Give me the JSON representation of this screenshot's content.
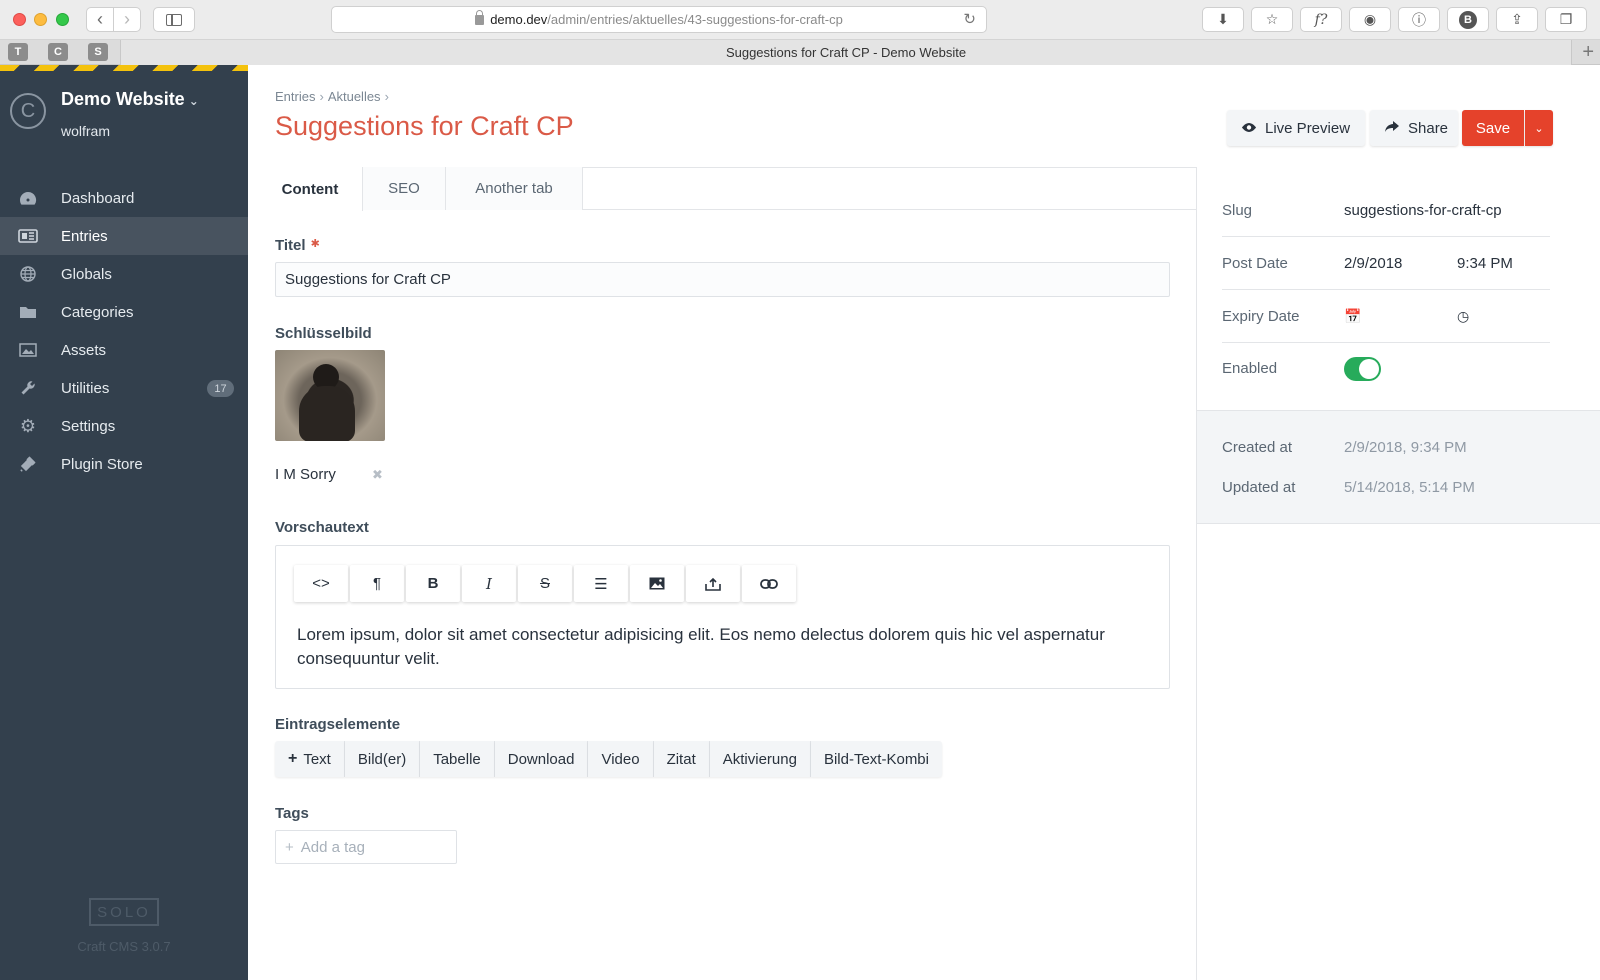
{
  "browser": {
    "url_host": "demo.dev",
    "url_path": "/admin/entries/aktuelles/43-suggestions-for-craft-cp",
    "tab_title": "Suggestions for Craft CP - Demo Website",
    "extensions": [
      "T",
      "C",
      "S"
    ]
  },
  "sidebar": {
    "site_name": "Demo Website",
    "user": "wolfram",
    "items": [
      {
        "label": "Dashboard",
        "icon": "dashboard-icon"
      },
      {
        "label": "Entries",
        "icon": "entries-icon",
        "active": true
      },
      {
        "label": "Globals",
        "icon": "globe-icon"
      },
      {
        "label": "Categories",
        "icon": "folder-icon"
      },
      {
        "label": "Assets",
        "icon": "image-icon"
      },
      {
        "label": "Utilities",
        "icon": "wrench-icon",
        "badge": "17"
      },
      {
        "label": "Settings",
        "icon": "gear-icon"
      },
      {
        "label": "Plugin Store",
        "icon": "plug-icon"
      }
    ],
    "edition": "SOLO",
    "version": "Craft CMS 3.0.7"
  },
  "header": {
    "breadcrumb": [
      "Entries",
      "Aktuelles"
    ],
    "title": "Suggestions for Craft CP",
    "live_preview": "Live Preview",
    "share": "Share",
    "save": "Save"
  },
  "tabs": [
    "Content",
    "SEO",
    "Another tab"
  ],
  "fields": {
    "title_label": "Titel",
    "title_value": "Suggestions for Craft CP",
    "image_label": "Schlüsselbild",
    "image_title": "I M Sorry",
    "preview_label": "Vorschautext",
    "preview_text": "Lorem ipsum, dolor sit amet consectetur adipisicing elit. Eos nemo delectus dolorem quis hic vel aspernatur consequuntur velit.",
    "toolbar": [
      "code-icon",
      "paragraph-icon",
      "bold-icon",
      "italic-icon",
      "strikethrough-icon",
      "list-icon",
      "image-icon",
      "upload-icon",
      "link-icon"
    ],
    "elements_label": "Eintragselemente",
    "elements": [
      "Text",
      "Bild(er)",
      "Tabelle",
      "Download",
      "Video",
      "Zitat",
      "Aktivierung",
      "Bild-Text-Kombi"
    ],
    "tags_label": "Tags",
    "tags_placeholder": "Add a tag"
  },
  "details": {
    "slug_label": "Slug",
    "slug": "suggestions-for-craft-cp",
    "post_date_label": "Post Date",
    "post_date": "2/9/2018",
    "post_time": "9:34 PM",
    "expiry_label": "Expiry Date",
    "enabled_label": "Enabled",
    "enabled": true,
    "created_label": "Created at",
    "created": "2/9/2018, 9:34 PM",
    "updated_label": "Updated at",
    "updated": "5/14/2018, 5:14 PM"
  }
}
